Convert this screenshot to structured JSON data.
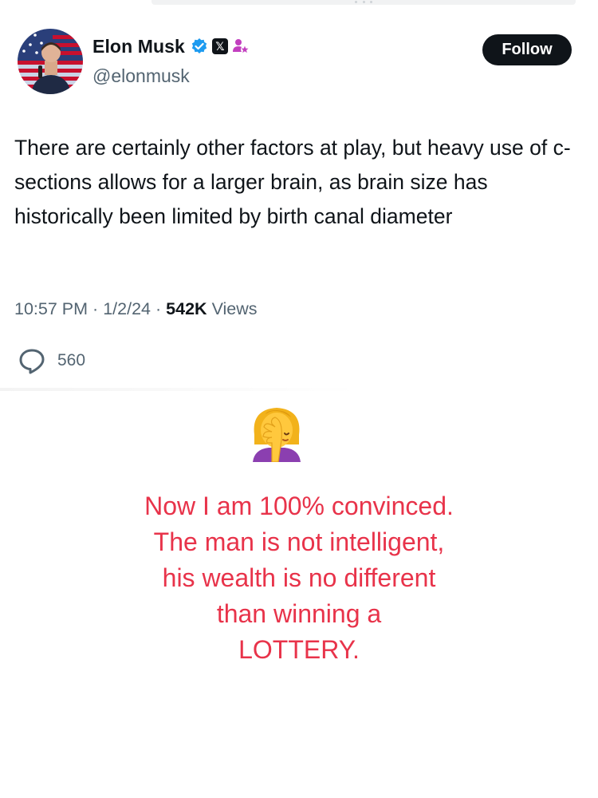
{
  "tweet": {
    "author": {
      "display_name": "Elon Musk",
      "handle": "@elonmusk",
      "verified_icon": "verified-badge-icon",
      "affiliation_icon": "x-logo-icon",
      "gov_icon": "government-affiliate-icon"
    },
    "follow_label": "Follow",
    "text": "There are certainly other factors at play, but heavy use of c-sections allows for a larger brain, as brain size has historically been limited by birth canal diameter",
    "time": "10:57 PM",
    "date": "1/2/24",
    "separator": "·",
    "views_count": "542K",
    "views_label": "Views",
    "reply_count": "560",
    "x_badge_glyph": "𝕏"
  },
  "reaction": {
    "emoji": "facepalm-woman-emoji",
    "caption_lines": [
      "Now I am 100% convinced.",
      "The man is not intelligent,",
      "his wealth is no different",
      "than winning a",
      "LOTTERY."
    ]
  },
  "colors": {
    "text_primary": "#0f1419",
    "text_secondary": "#536471",
    "verified_blue": "#1d9bf0",
    "caption_red": "#e8334a",
    "follow_bg": "#0f1419"
  }
}
